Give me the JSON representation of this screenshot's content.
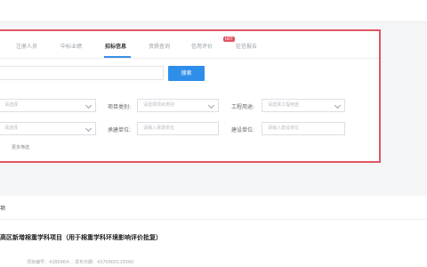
{
  "tabs": [
    {
      "label": "注册人员"
    },
    {
      "label": "中标业绩"
    },
    {
      "label": "招标信息"
    },
    {
      "label": "资质查询"
    },
    {
      "label": "信用评价"
    },
    {
      "label": "征信报告"
    }
  ],
  "active_tab": 2,
  "hot_badge": "HOT",
  "search": {
    "button_label": "搜索"
  },
  "filters": {
    "row1": [
      {
        "label": "",
        "placeholder": "请选择"
      },
      {
        "label": "项目类别:",
        "placeholder": "请选择项目类别"
      },
      {
        "label": "工程用途:",
        "placeholder": "请选择工程用途"
      }
    ],
    "row2": [
      {
        "label": "",
        "placeholder": "请选择"
      },
      {
        "label": "承建单位:",
        "placeholder": "请输入承建单位"
      },
      {
        "label": "建设单位:",
        "placeholder": "请输入建设单位"
      }
    ],
    "more": "更多筛选"
  },
  "results": {
    "section_label": "项",
    "title": "高区新增棉重学科项目（用于棉重学科环境影响评价批复）",
    "meta": [
      "项目编号：4380964...",
      "发布日期：4370000115560"
    ]
  },
  "colors": {
    "accent": "#2f8eea",
    "highlight": "#e25563"
  }
}
